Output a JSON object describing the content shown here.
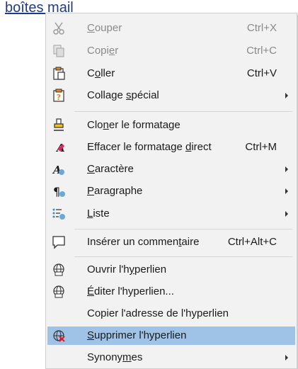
{
  "document": {
    "link_text": "boîtes mail"
  },
  "menu": {
    "items": [
      {
        "pre": "",
        "ul": "C",
        "post": "ouper",
        "shortcut": "Ctrl+X",
        "icon": "scissors-icon",
        "disabled": true
      },
      {
        "pre": "Copi",
        "ul": "e",
        "post": "r",
        "shortcut": "Ctrl+C",
        "icon": "copy-icon",
        "disabled": true
      },
      {
        "pre": "C",
        "ul": "o",
        "post": "ller",
        "shortcut": "Ctrl+V",
        "icon": "paste-icon",
        "disabled": false
      },
      {
        "pre": "Collage ",
        "ul": "s",
        "post": "pécial",
        "shortcut": "",
        "icon": "paste-special-icon",
        "disabled": false,
        "submenu": true
      },
      {
        "pre": "Clo",
        "ul": "n",
        "post": "er le formatage",
        "shortcut": "",
        "icon": "clone-formatting-icon",
        "disabled": false
      },
      {
        "pre": "Effacer le formatage ",
        "ul": "d",
        "post": "irect",
        "shortcut": "Ctrl+M",
        "icon": "clear-formatting-icon",
        "disabled": false
      },
      {
        "pre": "",
        "ul": "C",
        "post": "aractère",
        "shortcut": "",
        "icon": "character-icon",
        "disabled": false,
        "submenu": true
      },
      {
        "pre": "",
        "ul": "P",
        "post": "aragraphe",
        "shortcut": "",
        "icon": "paragraph-icon",
        "disabled": false,
        "submenu": true
      },
      {
        "pre": "",
        "ul": "L",
        "post": "iste",
        "shortcut": "",
        "icon": "list-icon",
        "disabled": false,
        "submenu": true
      },
      {
        "pre": "Insérer un commen",
        "ul": "t",
        "post": "aire",
        "shortcut": "Ctrl+Alt+C",
        "icon": "comment-icon",
        "disabled": false
      },
      {
        "pre": "Ouvrir l'h",
        "ul": "y",
        "post": "perlien",
        "shortcut": "",
        "icon": "open-hyperlink-icon",
        "disabled": false
      },
      {
        "pre": "",
        "ul": "É",
        "post": "diter l'hyperlien...",
        "shortcut": "",
        "icon": "edit-hyperlink-icon",
        "disabled": false
      },
      {
        "pre": "Copier l'adresse de l'hyperlien",
        "ul": "",
        "post": "",
        "shortcut": "",
        "icon": "",
        "disabled": false
      },
      {
        "pre": "",
        "ul": "S",
        "post": "upprimer l'hyperlien",
        "shortcut": "",
        "icon": "remove-hyperlink-icon",
        "disabled": false,
        "highlight": true
      },
      {
        "pre": "Synony",
        "ul": "m",
        "post": "es",
        "shortcut": "",
        "icon": "",
        "disabled": false,
        "submenu": true
      }
    ]
  }
}
